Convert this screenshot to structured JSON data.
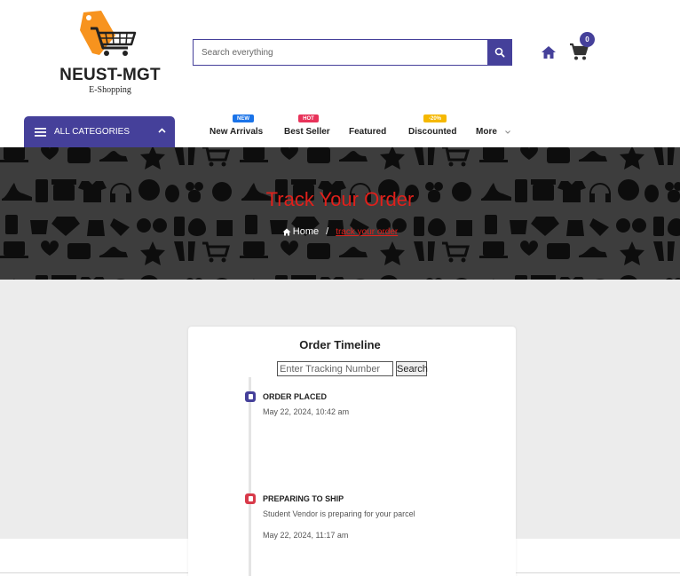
{
  "brand": {
    "name": "NEUST-MGT",
    "tagline": "E-Shopping",
    "accent": "#45409a",
    "logo_orange": "#f7931e"
  },
  "search": {
    "placeholder": "Search everything",
    "button_icon": "search-icon"
  },
  "header_icons": {
    "home_icon": "home-icon",
    "cart_icon": "cart-icon",
    "cart_count": "0"
  },
  "categories": {
    "label": "ALL CATEGORIES",
    "icon": "menu-icon",
    "chevron": "chevron-up-icon"
  },
  "nav": {
    "items": [
      {
        "label": "New Arrivals",
        "tag": "NEW",
        "tag_color": "#1a73e8"
      },
      {
        "label": "Best Seller",
        "tag": "HOT",
        "tag_color": "#e8335a"
      },
      {
        "label": "Featured",
        "tag": "",
        "tag_color": ""
      },
      {
        "label": "Discounted",
        "tag": "-20%",
        "tag_color": "#f5b800"
      },
      {
        "label": "More",
        "tag": "",
        "tag_color": ""
      }
    ]
  },
  "banner": {
    "title": "Track Your Order",
    "breadcrumb_home": "Home",
    "breadcrumb_separator": "/",
    "breadcrumb_current": "track your order",
    "title_color": "#e0201b"
  },
  "tracking": {
    "title": "Order Timeline",
    "input_placeholder": "Enter Tracking Number",
    "button_label": "Search"
  },
  "timeline": [
    {
      "status": "ORDER PLACED",
      "description": "",
      "time": "May 22, 2024, 10:42 am",
      "color": "#45409a"
    },
    {
      "status": "PREPARING TO SHIP",
      "description": "Student Vendor is preparing for your parcel",
      "time": "May 22, 2024, 11:17 am",
      "color": "#d83a4a"
    }
  ]
}
